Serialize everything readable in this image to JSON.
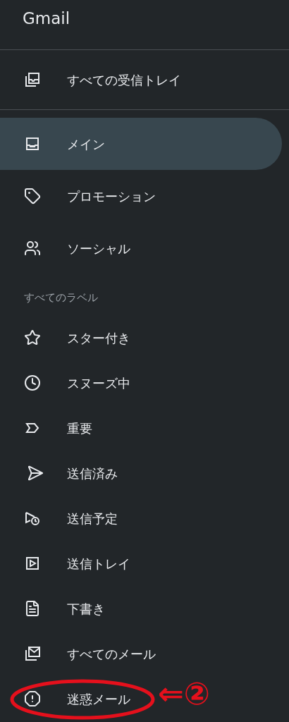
{
  "app_title": "Gmail",
  "top_item": {
    "label": "すべての受信トレイ",
    "selected": false
  },
  "categories": [
    {
      "label": "メイン",
      "selected": true
    },
    {
      "label": "プロモーション",
      "selected": false
    },
    {
      "label": "ソーシャル",
      "selected": false
    }
  ],
  "labels_header": "すべてのラベル",
  "labels": [
    {
      "label": "スター付き",
      "selected": false,
      "circled": false
    },
    {
      "label": "スヌーズ中",
      "selected": false,
      "circled": false
    },
    {
      "label": "重要",
      "selected": false,
      "circled": false
    },
    {
      "label": "送信済み",
      "selected": false,
      "circled": false
    },
    {
      "label": "送信予定",
      "selected": false,
      "circled": false
    },
    {
      "label": "送信トレイ",
      "selected": false,
      "circled": false
    },
    {
      "label": "下書き",
      "selected": false,
      "circled": false
    },
    {
      "label": "すべてのメール",
      "selected": false,
      "circled": false
    },
    {
      "label": "迷惑メール",
      "selected": false,
      "circled": true
    }
  ],
  "annotation": {
    "text": "⇐②"
  }
}
